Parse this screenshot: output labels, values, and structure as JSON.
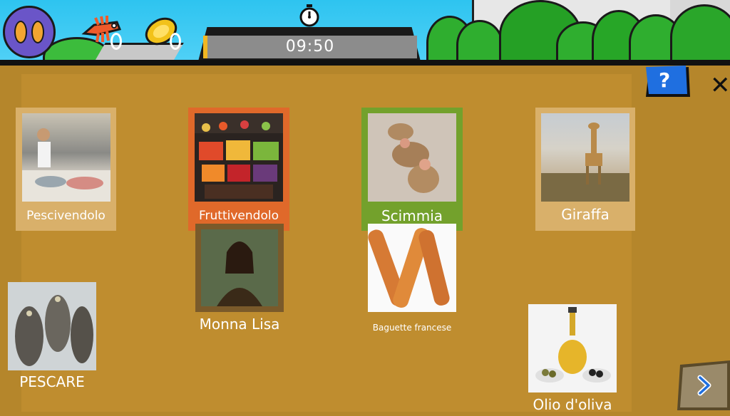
{
  "hud": {
    "timer": "09:50",
    "timer_progress": 0.02,
    "icons": [
      "footprints-icon",
      "fish-bone-icon",
      "gold-coin-icon",
      "stopwatch-icon"
    ]
  },
  "controls": {
    "help_label": "?",
    "close_label": "✕",
    "next_label": "›"
  },
  "cards": [
    {
      "label": "Pescivendolo",
      "state": "normal"
    },
    {
      "label": "Fruttivendolo",
      "state": "selected-red"
    },
    {
      "label": "Scimmia",
      "state": "selected-green"
    },
    {
      "label": "Giraffa",
      "state": "normal"
    },
    {
      "label": "Monna Lisa",
      "state": "loose"
    },
    {
      "label": "Baguette francese",
      "state": "loose"
    },
    {
      "label": "PESCARE",
      "state": "loose"
    },
    {
      "label": "Olio d'oliva",
      "state": "loose"
    }
  ],
  "colors": {
    "board": "#b5862b",
    "panel": "#bf8d2f",
    "card_frame": "#d9b06a",
    "selected_red": "#e0692a",
    "selected_green": "#73a12c",
    "accent_blue": "#1f6fe0"
  }
}
